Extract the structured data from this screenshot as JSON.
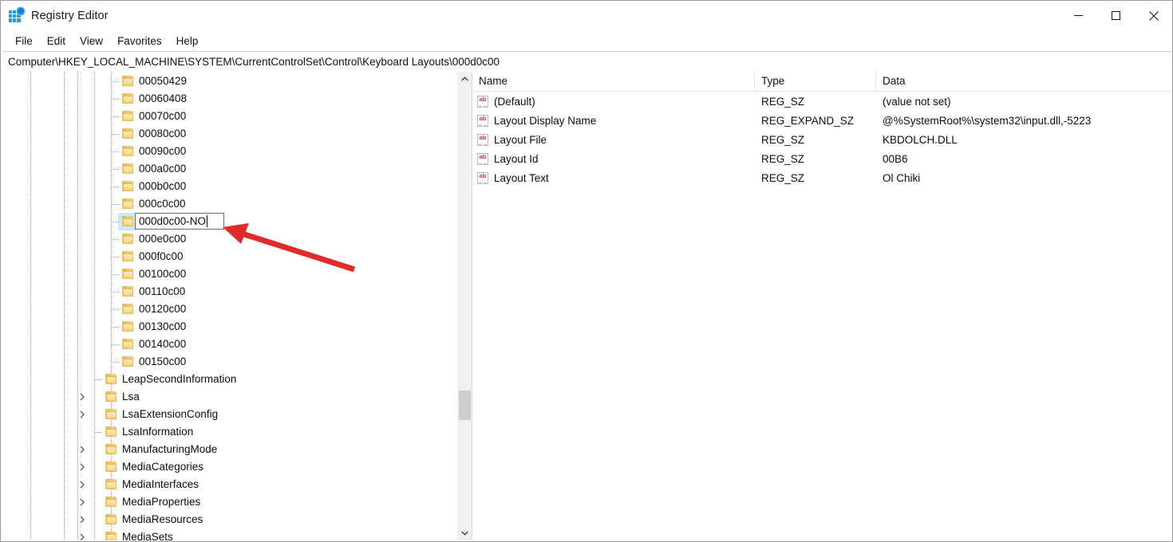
{
  "window": {
    "title": "Registry Editor",
    "app_icon": "registry-editor-icon",
    "controls": {
      "minimize": "minimize-icon",
      "maximize": "maximize-icon",
      "close": "close-icon"
    }
  },
  "menubar": {
    "items": [
      {
        "label": "File"
      },
      {
        "label": "Edit"
      },
      {
        "label": "View"
      },
      {
        "label": "Favorites"
      },
      {
        "label": "Help"
      }
    ]
  },
  "address": {
    "path": "Computer\\HKEY_LOCAL_MACHINE\\SYSTEM\\CurrentControlSet\\Control\\Keyboard Layouts\\000d0c00"
  },
  "tree": {
    "rows": [
      {
        "label": "00050429",
        "indent": 3,
        "expandable": false,
        "selected": false,
        "editing": false
      },
      {
        "label": "00060408",
        "indent": 3,
        "expandable": false,
        "selected": false,
        "editing": false
      },
      {
        "label": "00070c00",
        "indent": 3,
        "expandable": false,
        "selected": false,
        "editing": false
      },
      {
        "label": "00080c00",
        "indent": 3,
        "expandable": false,
        "selected": false,
        "editing": false
      },
      {
        "label": "00090c00",
        "indent": 3,
        "expandable": false,
        "selected": false,
        "editing": false
      },
      {
        "label": "000a0c00",
        "indent": 3,
        "expandable": false,
        "selected": false,
        "editing": false
      },
      {
        "label": "000b0c00",
        "indent": 3,
        "expandable": false,
        "selected": false,
        "editing": false
      },
      {
        "label": "000c0c00",
        "indent": 3,
        "expandable": false,
        "selected": false,
        "editing": false
      },
      {
        "label": "000d0c00-NO",
        "indent": 3,
        "expandable": false,
        "selected": true,
        "editing": true
      },
      {
        "label": "000e0c00",
        "indent": 3,
        "expandable": false,
        "selected": false,
        "editing": false
      },
      {
        "label": "000f0c00",
        "indent": 3,
        "expandable": false,
        "selected": false,
        "editing": false
      },
      {
        "label": "00100c00",
        "indent": 3,
        "expandable": false,
        "selected": false,
        "editing": false
      },
      {
        "label": "00110c00",
        "indent": 3,
        "expandable": false,
        "selected": false,
        "editing": false
      },
      {
        "label": "00120c00",
        "indent": 3,
        "expandable": false,
        "selected": false,
        "editing": false
      },
      {
        "label": "00130c00",
        "indent": 3,
        "expandable": false,
        "selected": false,
        "editing": false
      },
      {
        "label": "00140c00",
        "indent": 3,
        "expandable": false,
        "selected": false,
        "editing": false
      },
      {
        "label": "00150c00",
        "indent": 3,
        "expandable": false,
        "selected": false,
        "editing": false
      },
      {
        "label": "LeapSecondInformation",
        "indent": 2,
        "expandable": false,
        "selected": false,
        "editing": false
      },
      {
        "label": "Lsa",
        "indent": 2,
        "expandable": true,
        "selected": false,
        "editing": false
      },
      {
        "label": "LsaExtensionConfig",
        "indent": 2,
        "expandable": true,
        "selected": false,
        "editing": false
      },
      {
        "label": "LsaInformation",
        "indent": 2,
        "expandable": false,
        "selected": false,
        "editing": false
      },
      {
        "label": "ManufacturingMode",
        "indent": 2,
        "expandable": true,
        "selected": false,
        "editing": false
      },
      {
        "label": "MediaCategories",
        "indent": 2,
        "expandable": true,
        "selected": false,
        "editing": false
      },
      {
        "label": "MediaInterfaces",
        "indent": 2,
        "expandable": true,
        "selected": false,
        "editing": false
      },
      {
        "label": "MediaProperties",
        "indent": 2,
        "expandable": true,
        "selected": false,
        "editing": false
      },
      {
        "label": "MediaResources",
        "indent": 2,
        "expandable": true,
        "selected": false,
        "editing": false
      },
      {
        "label": "MediaSets",
        "indent": 2,
        "expandable": true,
        "selected": false,
        "editing": false
      }
    ]
  },
  "list": {
    "columns": [
      "Name",
      "Type",
      "Data"
    ],
    "rows": [
      {
        "name": "(Default)",
        "type": "REG_SZ",
        "data": "(value not set)"
      },
      {
        "name": "Layout Display Name",
        "type": "REG_EXPAND_SZ",
        "data": "@%SystemRoot%\\system32\\input.dll,-5223"
      },
      {
        "name": "Layout File",
        "type": "REG_SZ",
        "data": "KBDOLCH.DLL"
      },
      {
        "name": "Layout Id",
        "type": "REG_SZ",
        "data": "00B6"
      },
      {
        "name": "Layout Text",
        "type": "REG_SZ",
        "data": "Ol Chiki"
      }
    ]
  },
  "annotation": {
    "arrow_color": "#e02b2b"
  },
  "colors": {
    "folder": "#f2ca70",
    "selection": "#cde8f7",
    "accent": "#2b9ae0"
  }
}
